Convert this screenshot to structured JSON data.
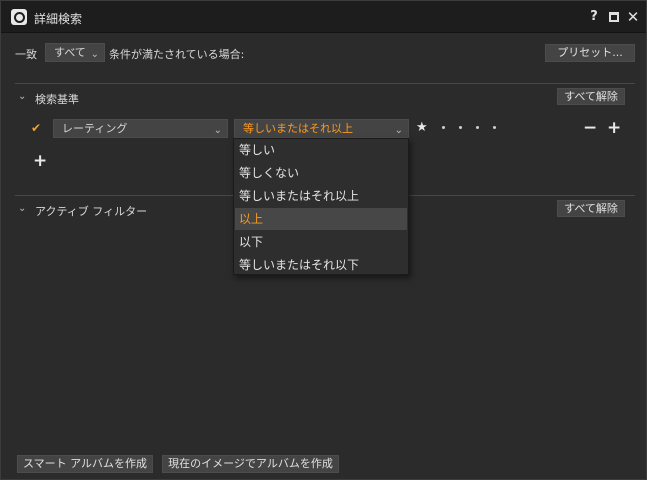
{
  "window": {
    "title": "詳細検索",
    "help": "?",
    "close": "✕"
  },
  "header": {
    "match_label": "一致",
    "match_value": "すべて",
    "condition_text": "条件が満たされている場合:",
    "preset_button": "プリセット..."
  },
  "criteria": {
    "section_title": "検索基準",
    "clear_all": "すべて解除",
    "rule": {
      "checked": true,
      "field": "レーティング",
      "operator": "等しいまたはそれ以上",
      "rating_star": "★"
    },
    "remove": "−",
    "add": "+",
    "add_rule": "+"
  },
  "operator_menu": {
    "items": [
      "等しい",
      "等しくない",
      "等しいまたはそれ以上",
      "以上",
      "以下",
      "等しいまたはそれ以下"
    ],
    "selected_index": 3
  },
  "active_filter": {
    "section_title": "アクティブ フィルター",
    "clear_all": "すべて解除"
  },
  "footer": {
    "smart_album_button": "スマート アルバムを作成",
    "current_images_button": "現在のイメージでアルバムを作成"
  },
  "colors": {
    "accent": "#ff9a1f",
    "background": "#2b2b2b",
    "control": "#444444"
  }
}
